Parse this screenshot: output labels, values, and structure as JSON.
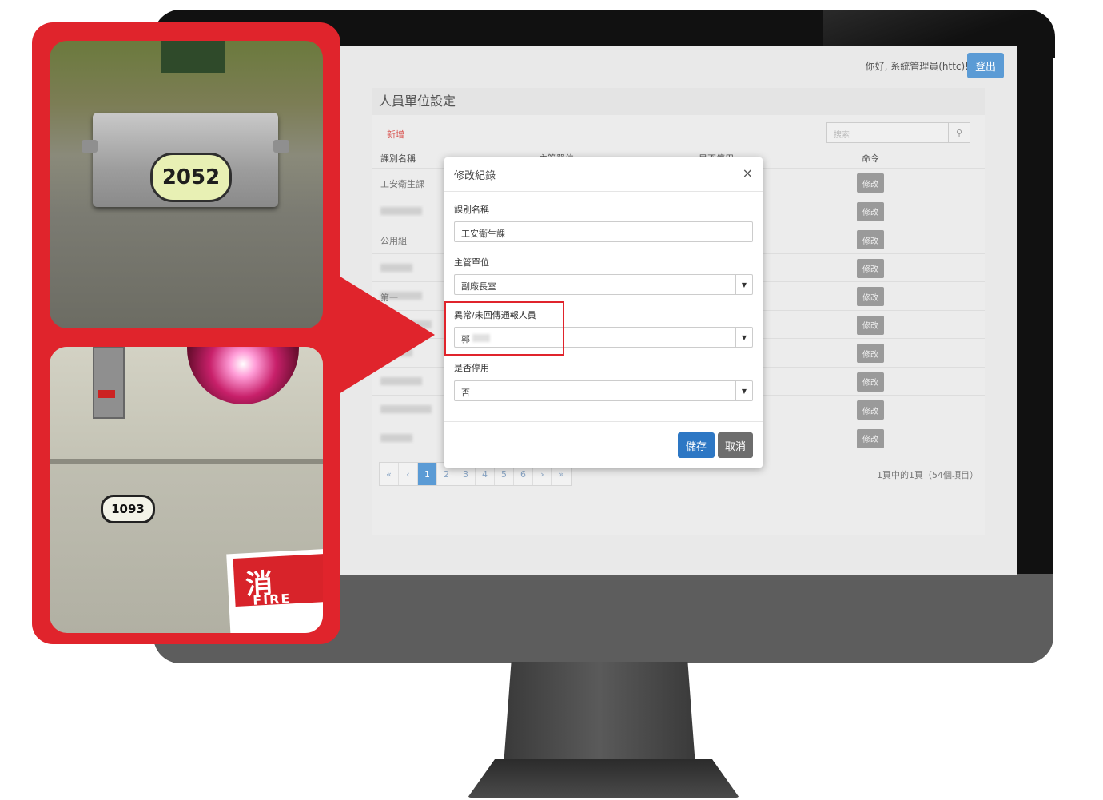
{
  "app": {
    "greeting": "你好, 系統管理員(httc)!",
    "logout_label": "登出"
  },
  "panel": {
    "title": "人員單位設定",
    "add_label": "新增",
    "search_placeholder": "搜索",
    "columns": [
      "課別名稱",
      "主管單位",
      "是否停用",
      "命令"
    ],
    "rows": [
      {
        "name": "工安衛生課",
        "blurred": false
      },
      {
        "name": "",
        "blurred": true
      },
      {
        "name": "公用組",
        "blurred": false
      },
      {
        "name": "",
        "blurred": true
      },
      {
        "name": "第一",
        "blurred": true
      },
      {
        "name": "",
        "blurred": true
      },
      {
        "name": "",
        "blurred": true
      },
      {
        "name": "",
        "blurred": true
      },
      {
        "name": "",
        "blurred": true
      },
      {
        "name": "",
        "blurred": true
      }
    ],
    "edit_label": "修改",
    "pagination": {
      "first": "«",
      "prev": "‹",
      "pages": [
        "1",
        "2",
        "3",
        "4",
        "5",
        "6"
      ],
      "current": "1",
      "next": "›",
      "last": "»",
      "info": "1頁中的1頁（54個項目）"
    }
  },
  "modal": {
    "title": "修改紀錄",
    "close_glyph": "×",
    "fields": {
      "section": {
        "label": "課別名稱",
        "value": "工安衛生課"
      },
      "supervisor": {
        "label": "主管單位",
        "value": "副廠長室"
      },
      "notify": {
        "label": "異常/未回傳通報人員",
        "value": "郭"
      },
      "disabled": {
        "label": "是否停用",
        "value": "否"
      }
    },
    "save_label": "儲存",
    "cancel_label": "取消"
  },
  "photos": {
    "tag_top": "2052",
    "tag_bottom": "1093",
    "sign_cn": "消",
    "sign_en": "FIRE"
  },
  "colors": {
    "accent_red": "#e0242c",
    "primary_blue": "#2d77c4",
    "logout_blue": "#5b9bd5"
  }
}
